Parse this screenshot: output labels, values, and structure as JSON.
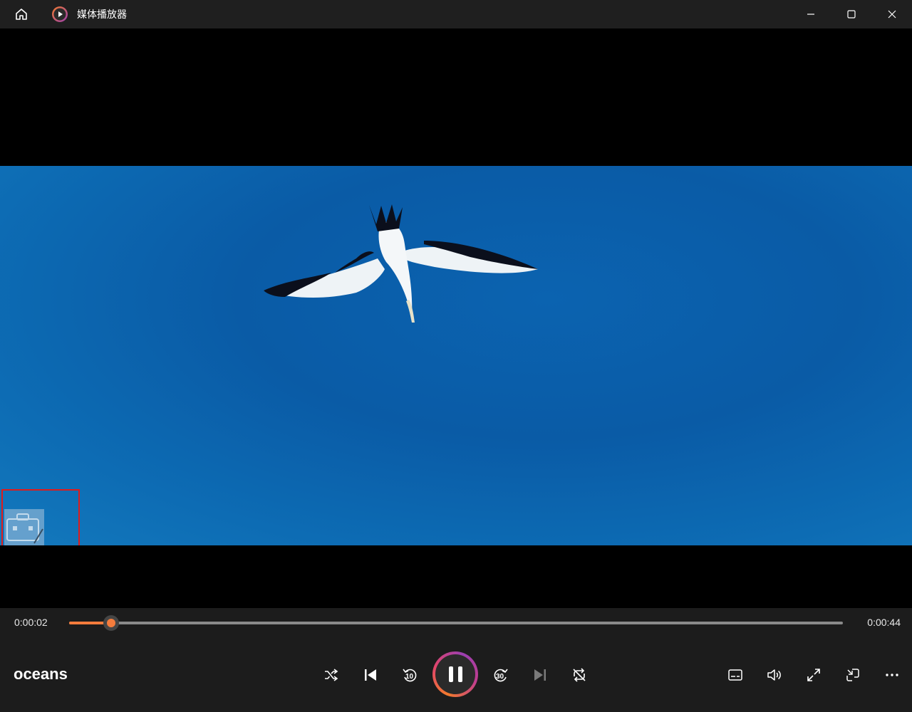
{
  "window": {
    "title": "媒体播放器"
  },
  "player": {
    "current_time": "0:00:02",
    "total_time": "0:00:44",
    "progress_fraction": 0.054,
    "media_title": "oceans",
    "skip_back_seconds": "10",
    "skip_forward_seconds": "30"
  },
  "colors": {
    "accent": "#f47c3c",
    "titlebar_bg": "#1f1f1f",
    "controls_bg": "#1c1c1c",
    "watermark_box": "#e01b1b"
  },
  "icons": {
    "home": "home-icon",
    "app": "media-player-icon",
    "minimize": "minimize-icon",
    "maximize": "maximize-icon",
    "close": "close-icon",
    "shuffle": "shuffle-icon",
    "previous": "previous-icon",
    "rewind": "rewind-10-icon",
    "pause": "pause-icon",
    "forward": "forward-30-icon",
    "next": "next-icon",
    "repeat": "repeat-off-icon",
    "subtitles": "subtitles-icon",
    "volume": "volume-icon",
    "fullscreen": "fullscreen-icon",
    "miniplayer": "miniplayer-icon",
    "more": "more-icon"
  }
}
